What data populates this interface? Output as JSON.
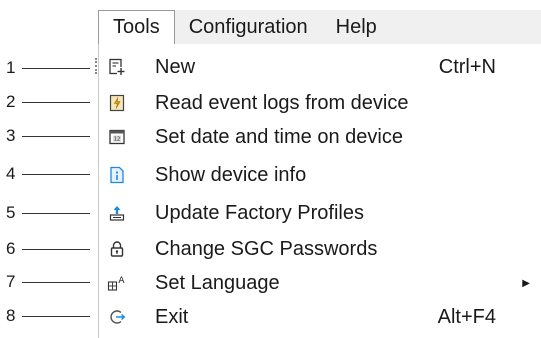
{
  "menubar": {
    "items": [
      {
        "label": "Tools"
      },
      {
        "label": "Configuration"
      },
      {
        "label": "Help"
      }
    ]
  },
  "menu": {
    "items": [
      {
        "callout": "1",
        "label": "New",
        "shortcut": "Ctrl+N",
        "icon": "new-document-icon"
      },
      {
        "callout": "2",
        "label": "Read event logs from device",
        "shortcut": "",
        "icon": "event-log-icon"
      },
      {
        "callout": "3",
        "label": "Set date and time on device",
        "shortcut": "",
        "icon": "calendar-icon"
      },
      {
        "callout": "4",
        "label": "Show device info",
        "shortcut": "",
        "icon": "info-icon"
      },
      {
        "callout": "5",
        "label": "Update Factory Profiles",
        "shortcut": "",
        "icon": "upload-icon"
      },
      {
        "callout": "6",
        "label": "Change SGC Passwords",
        "shortcut": "",
        "icon": "lock-icon"
      },
      {
        "callout": "7",
        "label": "Set Language",
        "shortcut": "",
        "icon": "language-icon",
        "has_submenu": true
      },
      {
        "callout": "8",
        "label": "Exit",
        "shortcut": "Alt+F4",
        "icon": "exit-icon"
      }
    ]
  },
  "colors": {
    "menubar_bg": "#f0f0f0",
    "info_blue": "#1e88e5",
    "log_orange": "#e0a020"
  }
}
